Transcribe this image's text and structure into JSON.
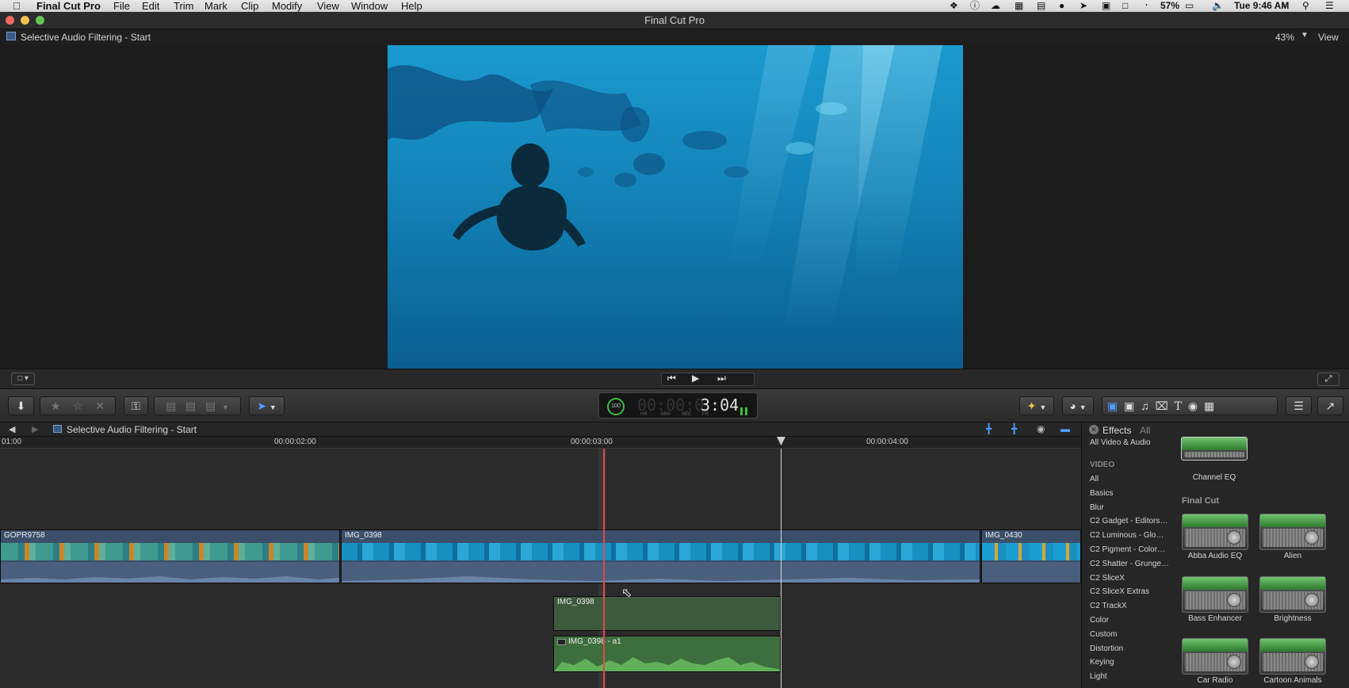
{
  "menubar": {
    "apple": "",
    "app": "Final Cut Pro",
    "items": [
      "File",
      "Edit",
      "Trim",
      "Mark",
      "Clip",
      "Modify",
      "View",
      "Window",
      "Help"
    ],
    "battery": "57%",
    "clock": "Tue 9:46 AM"
  },
  "window": {
    "title": "Final Cut Pro"
  },
  "viewer": {
    "project": "Selective Audio Filtering - Start",
    "zoom": "43%",
    "view_label": "View"
  },
  "timecode": {
    "display": "00:00:03:04",
    "dim_part": "00:00:0",
    "bright_part": "3:04",
    "ring": "100",
    "labels": [
      "HR",
      "MIN",
      "SEC",
      "FR"
    ]
  },
  "timeline": {
    "title": "Selective Audio Filtering - Start",
    "ruler": [
      "01:00",
      "00:00:02:00",
      "00:00:03:00",
      "00:00:04:00"
    ],
    "clips": [
      "GOPR9758",
      "IMG_0398",
      "IMG_0430"
    ],
    "connected_clip": "IMG_0398",
    "audio_clip": "IMG_0398 - a1"
  },
  "effects": {
    "title": "Effects",
    "filter": "All",
    "categories": [
      "All Video & Audio",
      "VIDEO",
      "All",
      "Basics",
      "Blur",
      "C2 Gadget - Editors…",
      "C2 Luminous - Glo…",
      "C2 Pigment - Color…",
      "C2 Shatter - Grunge…",
      "C2 SliceX",
      "C2 SliceX Extras",
      "C2 TrackX",
      "Color",
      "Custom",
      "Distortion",
      "Keying",
      "Light"
    ],
    "top_item": "Channel EQ",
    "group": "Final Cut",
    "items": [
      "Abba Audio EQ",
      "Alien",
      "Bass Enhancer",
      "Brightness",
      "Car Radio",
      "Cartoon Animals"
    ]
  }
}
